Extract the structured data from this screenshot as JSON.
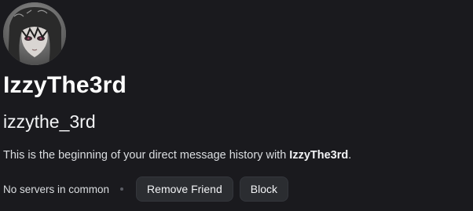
{
  "profile": {
    "display_name": "IzzyThe3rd",
    "username": "izzythe_3rd",
    "avatar_icon": "user-avatar-image"
  },
  "intro": {
    "prefix": "This is the beginning of your direct message history with ",
    "name": "IzzyThe3rd",
    "suffix": "."
  },
  "actions": {
    "mutual_servers": "No servers in common",
    "remove_friend_label": "Remove Friend",
    "block_label": "Block"
  },
  "colors": {
    "background": "#1a1a1e",
    "button_bg": "#2b2d31",
    "text_primary": "#ffffff"
  }
}
